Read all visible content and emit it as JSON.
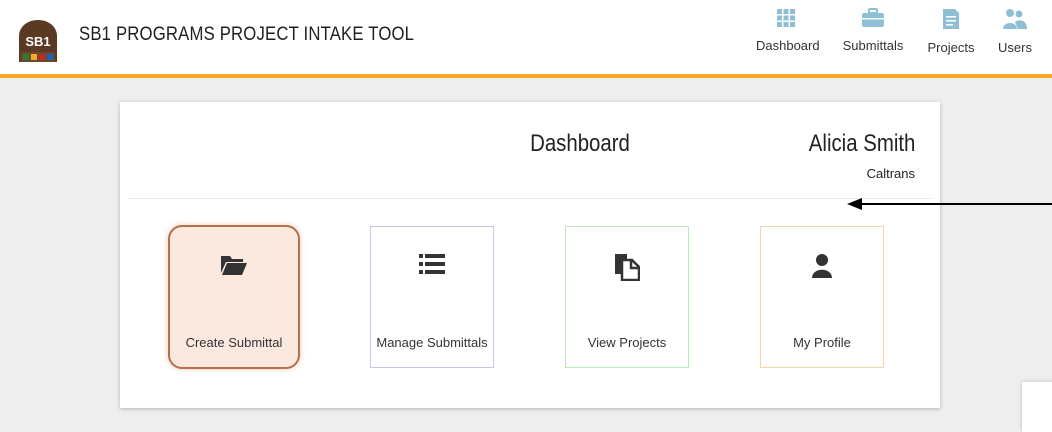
{
  "header": {
    "logo_text": "SB1",
    "title": "SB1 PROGRAMS PROJECT INTAKE TOOL",
    "nav": [
      {
        "label": "Dashboard",
        "icon": "grid-icon"
      },
      {
        "label": "Submittals",
        "icon": "briefcase-icon"
      },
      {
        "label": "Projects",
        "icon": "document-icon"
      },
      {
        "label": "Users",
        "icon": "users-icon"
      }
    ]
  },
  "card": {
    "title": "Dashboard",
    "user_name": "Alicia Smith",
    "user_org": "Caltrans"
  },
  "tiles": [
    {
      "label": "Create Submittal",
      "icon": "folder-open-icon"
    },
    {
      "label": "Manage Submittals",
      "icon": "list-icon"
    },
    {
      "label": "View Projects",
      "icon": "documents-icon"
    },
    {
      "label": "My Profile",
      "icon": "user-icon"
    }
  ],
  "colors": {
    "accent_bar": "#f2a823",
    "nav_icon": "#8fbfd4",
    "tile_icon": "#333333",
    "create_tile_bg": "#fbe9df",
    "create_tile_border": "#b3724c"
  }
}
